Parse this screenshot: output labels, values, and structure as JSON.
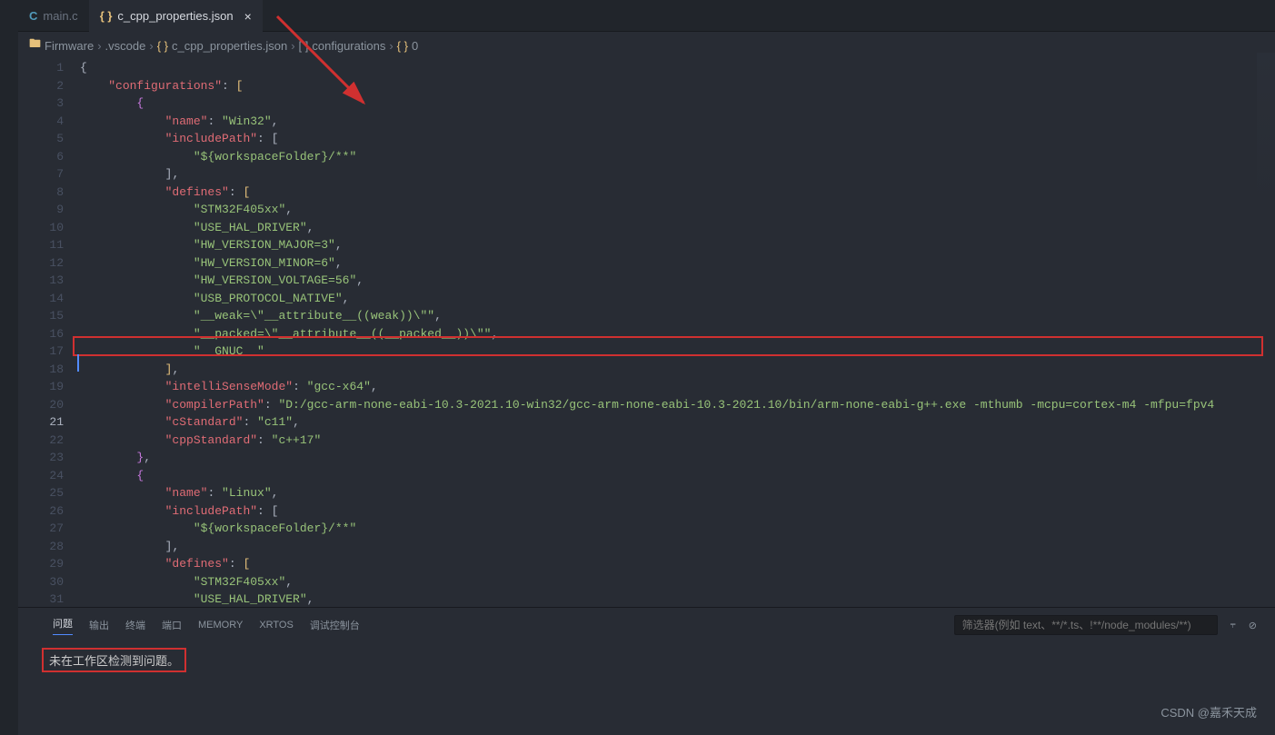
{
  "tabs": [
    {
      "icon": "C",
      "label": "main.c",
      "active": false,
      "closable": false
    },
    {
      "icon": "{ }",
      "label": "c_cpp_properties.json",
      "active": true,
      "closable": true
    }
  ],
  "breadcrumbs": {
    "parts": [
      "Firmware",
      ".vscode",
      "c_cpp_properties.json",
      "configurations",
      "0"
    ],
    "icons": [
      "folder",
      "text",
      "json",
      "array",
      "object"
    ]
  },
  "lines": [
    {
      "n": 1,
      "tokens": [
        [
          "brace",
          "{"
        ]
      ]
    },
    {
      "n": 2,
      "tokens": [
        [
          "pun",
          "    "
        ],
        [
          "key",
          "\"configurations\""
        ],
        [
          "pun",
          ": "
        ],
        [
          "y",
          "["
        ]
      ]
    },
    {
      "n": 3,
      "tokens": [
        [
          "pun",
          "        "
        ],
        [
          "p",
          "{"
        ]
      ]
    },
    {
      "n": 4,
      "tokens": [
        [
          "pun",
          "            "
        ],
        [
          "key",
          "\"name\""
        ],
        [
          "pun",
          ": "
        ],
        [
          "str",
          "\"Win32\""
        ],
        [
          "pun",
          ","
        ]
      ]
    },
    {
      "n": 5,
      "tokens": [
        [
          "pun",
          "            "
        ],
        [
          "key",
          "\"includePath\""
        ],
        [
          "pun",
          ": "
        ],
        [
          "brace",
          "["
        ]
      ]
    },
    {
      "n": 6,
      "tokens": [
        [
          "pun",
          "                "
        ],
        [
          "str",
          "\"${workspaceFolder}/**\""
        ]
      ]
    },
    {
      "n": 7,
      "tokens": [
        [
          "pun",
          "            "
        ],
        [
          "brace",
          "]"
        ],
        [
          "pun",
          ","
        ]
      ]
    },
    {
      "n": 8,
      "tokens": [
        [
          "pun",
          "            "
        ],
        [
          "key",
          "\"defines\""
        ],
        [
          "pun",
          ": "
        ],
        [
          "y",
          "["
        ]
      ]
    },
    {
      "n": 9,
      "tokens": [
        [
          "pun",
          "                "
        ],
        [
          "str",
          "\"STM32F405xx\""
        ],
        [
          "pun",
          ","
        ]
      ]
    },
    {
      "n": 10,
      "tokens": [
        [
          "pun",
          "                "
        ],
        [
          "str",
          "\"USE_HAL_DRIVER\""
        ],
        [
          "pun",
          ","
        ]
      ]
    },
    {
      "n": 11,
      "tokens": [
        [
          "pun",
          "                "
        ],
        [
          "str",
          "\"HW_VERSION_MAJOR=3\""
        ],
        [
          "pun",
          ","
        ]
      ]
    },
    {
      "n": 12,
      "tokens": [
        [
          "pun",
          "                "
        ],
        [
          "str",
          "\"HW_VERSION_MINOR=6\""
        ],
        [
          "pun",
          ","
        ]
      ]
    },
    {
      "n": 13,
      "tokens": [
        [
          "pun",
          "                "
        ],
        [
          "str",
          "\"HW_VERSION_VOLTAGE=56\""
        ],
        [
          "pun",
          ","
        ]
      ]
    },
    {
      "n": 14,
      "tokens": [
        [
          "pun",
          "                "
        ],
        [
          "str",
          "\"USB_PROTOCOL_NATIVE\""
        ],
        [
          "pun",
          ","
        ]
      ]
    },
    {
      "n": 15,
      "tokens": [
        [
          "pun",
          "                "
        ],
        [
          "str",
          "\"__weak=\\\"__attribute__((weak))\\\"\""
        ],
        [
          "pun",
          ","
        ]
      ]
    },
    {
      "n": 16,
      "tokens": [
        [
          "pun",
          "                "
        ],
        [
          "str",
          "\"__packed=\\\"__attribute__((__packed__))\\\"\""
        ],
        [
          "pun",
          ","
        ]
      ]
    },
    {
      "n": 17,
      "tokens": [
        [
          "pun",
          "                "
        ],
        [
          "str",
          "\"__GNUC__\""
        ]
      ]
    },
    {
      "n": 18,
      "tokens": [
        [
          "pun",
          "            "
        ],
        [
          "y",
          "]"
        ],
        [
          "pun",
          ","
        ]
      ]
    },
    {
      "n": 19,
      "tokens": [
        [
          "pun",
          "            "
        ],
        [
          "key",
          "\"intelliSenseMode\""
        ],
        [
          "pun",
          ": "
        ],
        [
          "str",
          "\"gcc-x64\""
        ],
        [
          "pun",
          ","
        ]
      ]
    },
    {
      "n": 20,
      "tokens": [
        [
          "pun",
          "            "
        ],
        [
          "key",
          "\"compilerPath\""
        ],
        [
          "pun",
          ": "
        ],
        [
          "str",
          "\"D:/gcc-arm-none-eabi-10.3-2021.10-win32/gcc-arm-none-eabi-10.3-2021.10/bin/arm-none-eabi-g++.exe -mthumb -mcpu=cortex-m4 -mfpu=fpv4"
        ]
      ]
    },
    {
      "n": 21,
      "tokens": [
        [
          "pun",
          "            "
        ],
        [
          "key",
          "\"cStandard\""
        ],
        [
          "pun",
          ": "
        ],
        [
          "str",
          "\"c11\""
        ],
        [
          "pun",
          ","
        ]
      ]
    },
    {
      "n": 22,
      "tokens": [
        [
          "pun",
          "            "
        ],
        [
          "key",
          "\"cppStandard\""
        ],
        [
          "pun",
          ": "
        ],
        [
          "str",
          "\"c++17\""
        ]
      ]
    },
    {
      "n": 23,
      "tokens": [
        [
          "pun",
          "        "
        ],
        [
          "p",
          "}"
        ],
        [
          "pun",
          ","
        ]
      ]
    },
    {
      "n": 24,
      "tokens": [
        [
          "pun",
          "        "
        ],
        [
          "p",
          "{"
        ]
      ]
    },
    {
      "n": 25,
      "tokens": [
        [
          "pun",
          "            "
        ],
        [
          "key",
          "\"name\""
        ],
        [
          "pun",
          ": "
        ],
        [
          "str",
          "\"Linux\""
        ],
        [
          "pun",
          ","
        ]
      ]
    },
    {
      "n": 26,
      "tokens": [
        [
          "pun",
          "            "
        ],
        [
          "key",
          "\"includePath\""
        ],
        [
          "pun",
          ": "
        ],
        [
          "brace",
          "["
        ]
      ]
    },
    {
      "n": 27,
      "tokens": [
        [
          "pun",
          "                "
        ],
        [
          "str",
          "\"${workspaceFolder}/**\""
        ]
      ]
    },
    {
      "n": 28,
      "tokens": [
        [
          "pun",
          "            "
        ],
        [
          "brace",
          "]"
        ],
        [
          "pun",
          ","
        ]
      ]
    },
    {
      "n": 29,
      "tokens": [
        [
          "pun",
          "            "
        ],
        [
          "key",
          "\"defines\""
        ],
        [
          "pun",
          ": "
        ],
        [
          "y",
          "["
        ]
      ]
    },
    {
      "n": 30,
      "tokens": [
        [
          "pun",
          "                "
        ],
        [
          "str",
          "\"STM32F405xx\""
        ],
        [
          "pun",
          ","
        ]
      ]
    },
    {
      "n": 31,
      "tokens": [
        [
          "pun",
          "                "
        ],
        [
          "str",
          "\"USE_HAL_DRIVER\""
        ],
        [
          "pun",
          ","
        ]
      ]
    }
  ],
  "currentLine": 21,
  "panel": {
    "tabs": [
      "问题",
      "输出",
      "终端",
      "端口",
      "MEMORY",
      "XRTOS",
      "调试控制台"
    ],
    "activeTab": 0,
    "filterPlaceholder": "筛选器(例如 text、**/*.ts、!**/node_modules/**)",
    "message": "未在工作区检测到问题。"
  },
  "watermark": "CSDN @嘉禾天成"
}
